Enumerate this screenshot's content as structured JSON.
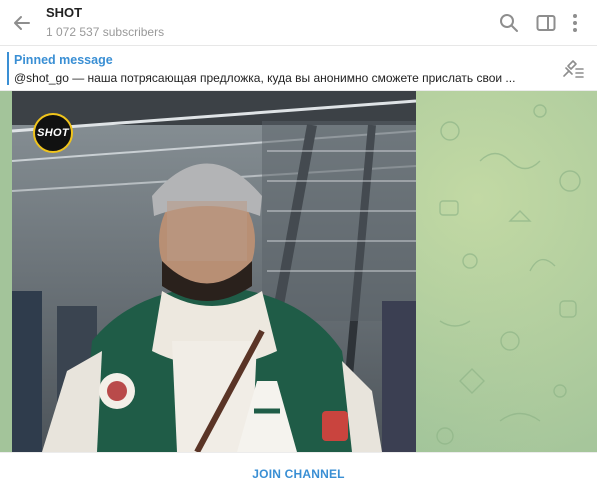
{
  "header": {
    "title": "SHOT",
    "subscribers": "1 072 537 subscribers",
    "icons": {
      "back": "arrow-left-icon",
      "search": "search-icon",
      "sidebar": "sidebar-toggle-icon",
      "menu": "more-vertical-icon"
    }
  },
  "pinned": {
    "title": "Pinned message",
    "text": "@shot_go — наша потрясающая предложка, куда вы анонимно сможете прислать свои ...",
    "icon": "unpin-icon"
  },
  "message": {
    "media_type": "video",
    "logo_text": "SHOT"
  },
  "footer": {
    "join_label": "JOIN CHANNEL"
  },
  "colors": {
    "accent": "#3a8fd4",
    "chat_background": "#a3c49a"
  }
}
